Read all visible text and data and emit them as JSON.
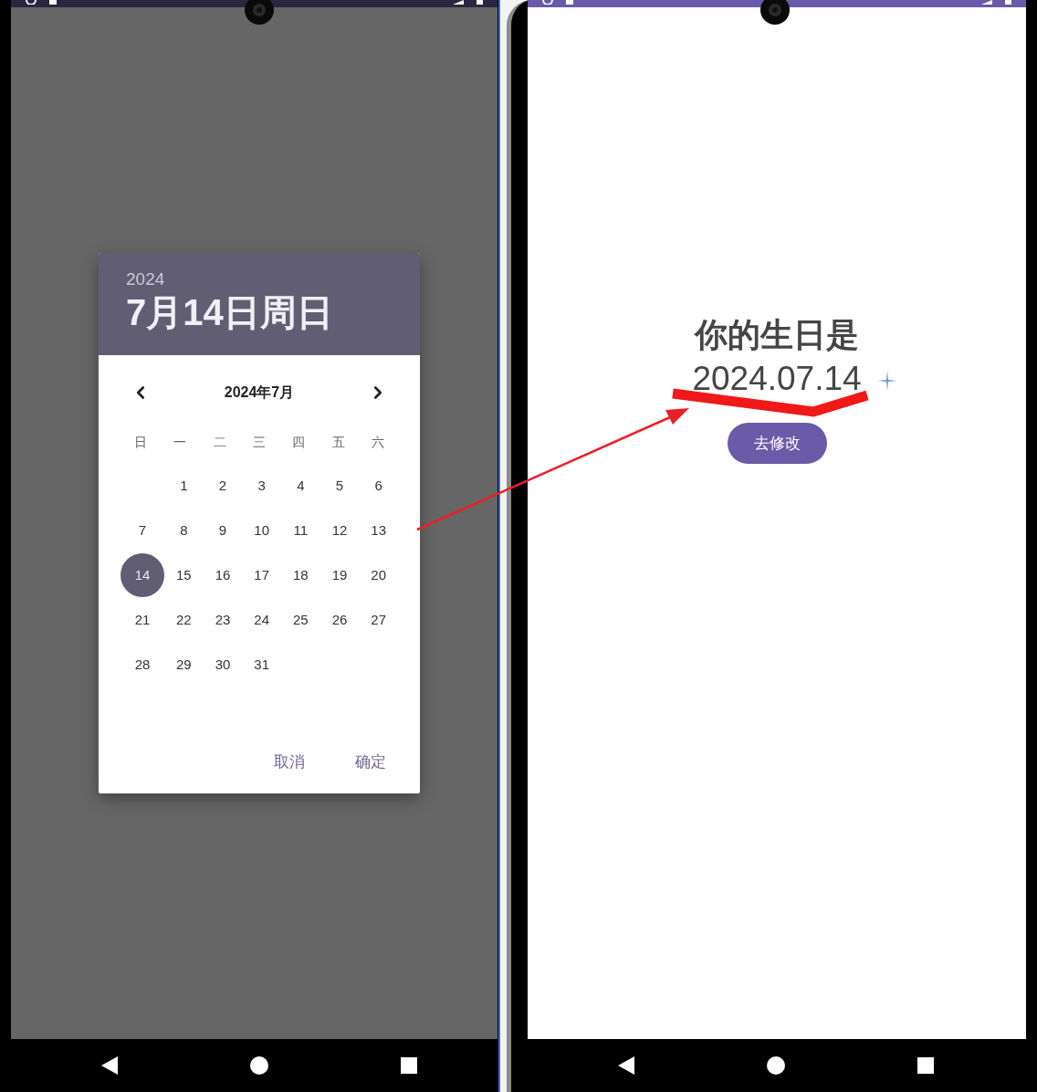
{
  "left_phone": {
    "dialog": {
      "year": "2024",
      "date_title": "7月14日周日",
      "month_label": "2024年7月",
      "weekdays": [
        "日",
        "一",
        "二",
        "三",
        "四",
        "五",
        "六"
      ],
      "weeks": [
        {
          "days": [
            {
              "label": "1",
              "selected": false
            },
            {
              "label": "2",
              "selected": false
            },
            {
              "label": "3",
              "selected": false
            },
            {
              "label": "4",
              "selected": false
            },
            {
              "label": "5",
              "selected": false
            },
            {
              "label": "6",
              "selected": false
            }
          ]
        },
        {
          "days": [
            {
              "label": "7",
              "selected": false
            },
            {
              "label": "8",
              "selected": false
            },
            {
              "label": "9",
              "selected": false
            },
            {
              "label": "10",
              "selected": false
            },
            {
              "label": "11",
              "selected": false
            },
            {
              "label": "12",
              "selected": false
            },
            {
              "label": "13",
              "selected": false
            }
          ]
        },
        {
          "days": [
            {
              "label": "14",
              "selected": true
            },
            {
              "label": "15",
              "selected": false
            },
            {
              "label": "16",
              "selected": false
            },
            {
              "label": "17",
              "selected": false
            },
            {
              "label": "18",
              "selected": false
            },
            {
              "label": "19",
              "selected": false
            },
            {
              "label": "20",
              "selected": false
            }
          ]
        },
        {
          "days": [
            {
              "label": "21",
              "selected": false
            },
            {
              "label": "22",
              "selected": false
            },
            {
              "label": "23",
              "selected": false
            },
            {
              "label": "24",
              "selected": false
            },
            {
              "label": "25",
              "selected": false
            },
            {
              "label": "26",
              "selected": false
            },
            {
              "label": "27",
              "selected": false
            }
          ]
        },
        {
          "days": [
            {
              "label": "28",
              "selected": false
            },
            {
              "label": "29",
              "selected": false
            },
            {
              "label": "30",
              "selected": false
            },
            {
              "label": "31",
              "selected": false
            }
          ]
        }
      ],
      "buttons": [
        {
          "label": "取消"
        },
        {
          "label": "确定"
        }
      ]
    }
  },
  "right_phone": {
    "title": "你的生日是",
    "date": "2024.07.14",
    "button": "去修改"
  }
}
